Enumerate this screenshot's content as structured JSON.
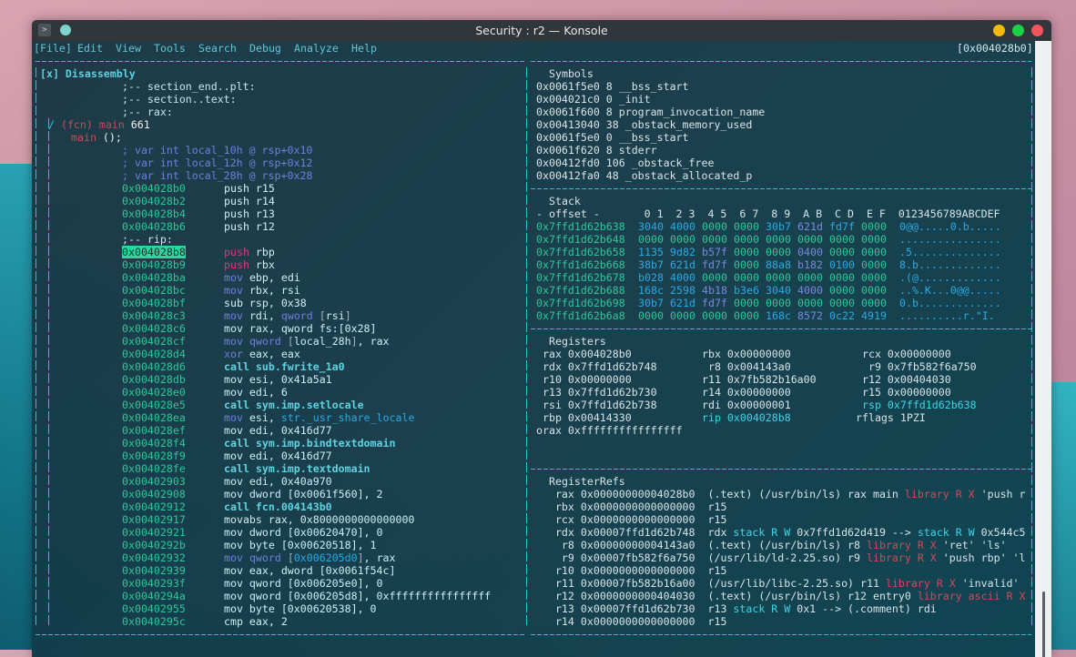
{
  "window": {
    "title": "Security : r2 — Konsole",
    "buttons": {
      "minimize_color": "#f5b90f",
      "maximize_color": "#1bd144",
      "close_color": "#f2545b"
    }
  },
  "menubar": {
    "items": [
      "[File]",
      "Edit",
      "View",
      "Tools",
      "Search",
      "Debug",
      "Analyze",
      "Help"
    ],
    "current_address": "[0x004028b0]"
  },
  "disassembly": {
    "title": "[x] Disassembly",
    "header_comments": [
      ";-- section_end..plt:",
      ";-- section..text:",
      ";-- rax:"
    ],
    "function": {
      "marker": "/",
      "label": "(fcn) main",
      "size": "661",
      "signature_name": "main",
      "signature_rest": " ();"
    },
    "vars": [
      "; var int local_10h @ rsp+0x10",
      "; var int local_12h @ rsp+0x12",
      "; var int local_28h @ rsp+0x28"
    ],
    "rip_label": ";-- rip:",
    "current_address": "0x004028b8",
    "lines": [
      {
        "addr": "0x004028b0",
        "ins": "push r15"
      },
      {
        "addr": "0x004028b2",
        "ins": "push r14"
      },
      {
        "addr": "0x004028b4",
        "ins": "push r13"
      },
      {
        "addr": "0x004028b6",
        "ins": "push r12"
      },
      {
        "rip": true
      },
      {
        "addr": "0x004028b8",
        "ins": "push rbp"
      },
      {
        "addr": "0x004028b9",
        "ins": "push rbx"
      },
      {
        "addr": "0x004028ba",
        "ins": "mov ebp, edi"
      },
      {
        "addr": "0x004028bc",
        "ins": "mov rbx, rsi"
      },
      {
        "addr": "0x004028bf",
        "ins": "sub rsp, 0x38"
      },
      {
        "addr": "0x004028c3",
        "ins": "mov rdi, qword [rsi]"
      },
      {
        "addr": "0x004028c6",
        "ins": "mov rax, qword fs:[0x28]"
      },
      {
        "addr": "0x004028cf",
        "ins": "mov qword [local_28h], rax"
      },
      {
        "addr": "0x004028d4",
        "ins": "xor eax, eax"
      },
      {
        "addr": "0x004028d6",
        "ins": "call sub.fwrite_1a0"
      },
      {
        "addr": "0x004028db",
        "ins": "mov esi, 0x41a5a1"
      },
      {
        "addr": "0x004028e0",
        "ins": "mov edi, 6"
      },
      {
        "addr": "0x004028e5",
        "ins": "call sym.imp.setlocale"
      },
      {
        "addr": "0x004028ea",
        "ins": "mov esi, str._usr_share_locale"
      },
      {
        "addr": "0x004028ef",
        "ins": "mov edi, 0x416d77"
      },
      {
        "addr": "0x004028f4",
        "ins": "call sym.imp.bindtextdomain"
      },
      {
        "addr": "0x004028f9",
        "ins": "mov edi, 0x416d77"
      },
      {
        "addr": "0x004028fe",
        "ins": "call sym.imp.textdomain"
      },
      {
        "addr": "0x00402903",
        "ins": "mov edi, 0x40a970"
      },
      {
        "addr": "0x00402908",
        "ins": "mov dword [0x0061f560], 2"
      },
      {
        "addr": "0x00402912",
        "ins": "call fcn.004143b0"
      },
      {
        "addr": "0x00402917",
        "ins": "movabs rax, 0x8000000000000000"
      },
      {
        "addr": "0x00402921",
        "ins": "mov dword [0x00620470], 0"
      },
      {
        "addr": "0x0040292b",
        "ins": "mov byte [0x00620518], 1"
      },
      {
        "addr": "0x00402932",
        "ins": "mov qword [0x006205d0], rax"
      },
      {
        "addr": "0x00402939",
        "ins": "mov eax, dword [0x0061f54c]"
      },
      {
        "addr": "0x0040293f",
        "ins": "mov qword [0x006205e0], 0"
      },
      {
        "addr": "0x0040294a",
        "ins": "mov qword [0x006205d8], 0xffffffffffffffff"
      },
      {
        "addr": "0x00402955",
        "ins": "mov byte [0x00620538], 0"
      },
      {
        "addr": "0x0040295c",
        "ins": "cmp eax, 2"
      }
    ]
  },
  "symbols": {
    "title": "Symbols",
    "rows": [
      "0x0061f5e0 8 __bss_start",
      "0x004021c0 0 _init",
      "0x0061f600 8 program_invocation_name",
      "0x00413040 38 _obstack_memory_used",
      "0x0061f5e0 0 __bss_start",
      "0x0061f620 8 stderr",
      "0x00412fd0 106 _obstack_free",
      "0x00412fa0 48 _obstack_allocated_p"
    ]
  },
  "stack": {
    "title": "Stack",
    "header": "- offset -       0 1  2 3  4 5  6 7  8 9  A B  C D  E F  0123456789ABCDEF",
    "rows": [
      {
        "offset": "0x7ffd1d62b638",
        "words": [
          "3040",
          "4000",
          "0000",
          "0000",
          "30b7",
          "621d",
          "fd7f",
          "0000"
        ],
        "ascii": "0@@.....0.b....."
      },
      {
        "offset": "0x7ffd1d62b648",
        "words": [
          "0000",
          "0000",
          "0000",
          "0000",
          "0000",
          "0000",
          "0000",
          "0000"
        ],
        "ascii": "................"
      },
      {
        "offset": "0x7ffd1d62b658",
        "words": [
          "1135",
          "9d82",
          "b57f",
          "0000",
          "0000",
          "0400",
          "0000",
          "0000"
        ],
        "ascii": ".5.............."
      },
      {
        "offset": "0x7ffd1d62b668",
        "words": [
          "38b7",
          "621d",
          "fd7f",
          "0000",
          "88a8",
          "b182",
          "0100",
          "0000"
        ],
        "ascii": "8.b............."
      },
      {
        "offset": "0x7ffd1d62b678",
        "words": [
          "b028",
          "4000",
          "0000",
          "0000",
          "0000",
          "0000",
          "0000",
          "0000"
        ],
        "ascii": ".(@............."
      },
      {
        "offset": "0x7ffd1d62b688",
        "words": [
          "168c",
          "2598",
          "4b18",
          "b3e6",
          "3040",
          "4000",
          "0000",
          "0000"
        ],
        "ascii": "..%.K...0@@....."
      },
      {
        "offset": "0x7ffd1d62b698",
        "words": [
          "30b7",
          "621d",
          "fd7f",
          "0000",
          "0000",
          "0000",
          "0000",
          "0000"
        ],
        "ascii": "0.b............."
      },
      {
        "offset": "0x7ffd1d62b6a8",
        "words": [
          "0000",
          "0000",
          "0000",
          "0000",
          "168c",
          "8572",
          "0c22",
          "4919"
        ],
        "ascii": "..........r.\"I."
      }
    ]
  },
  "registers": {
    "title": "Registers",
    "rows": [
      [
        {
          "name": "rax",
          "value": "0x004028b0"
        },
        {
          "name": "rbx",
          "value": "0x00000000"
        },
        {
          "name": "rcx",
          "value": "0x00000000"
        }
      ],
      [
        {
          "name": "rdx",
          "value": "0x7ffd1d62b748"
        },
        {
          "name": "r8",
          "value": "0x004143a0"
        },
        {
          "name": "r9",
          "value": "0x7fb582f6a750"
        }
      ],
      [
        {
          "name": "r10",
          "value": "0x00000000"
        },
        {
          "name": "r11",
          "value": "0x7fb582b16a00"
        },
        {
          "name": "r12",
          "value": "0x00404030"
        }
      ],
      [
        {
          "name": "r13",
          "value": "0x7ffd1d62b730"
        },
        {
          "name": "r14",
          "value": "0x00000000"
        },
        {
          "name": "r15",
          "value": "0x00000000"
        }
      ],
      [
        {
          "name": "rsi",
          "value": "0x7ffd1d62b738"
        },
        {
          "name": "rdi",
          "value": "0x00000001"
        },
        {
          "name": "rsp",
          "value": "0x7ffd1d62b638",
          "highlight": true
        }
      ],
      [
        {
          "name": "rbp",
          "value": "0x00414330"
        },
        {
          "name": "rip",
          "value": "0x004028b8",
          "highlight": true
        },
        {
          "name": "rflags",
          "value": "1PZI"
        }
      ],
      [
        {
          "name": "orax",
          "value": "0xffffffffffffffff"
        }
      ]
    ]
  },
  "register_refs": {
    "title": "RegisterRefs",
    "rows": [
      {
        "name": "rax",
        "value": "0x00000000004028b0",
        "desc": [
          [
            "(.text) (/usr/bin/ls) rax main ",
            "light"
          ],
          [
            "library R X",
            "red"
          ],
          [
            " 'push r",
            "light"
          ]
        ]
      },
      {
        "name": "rbx",
        "value": "0x0000000000000000",
        "desc": [
          [
            "r15",
            "light"
          ]
        ]
      },
      {
        "name": "rcx",
        "value": "0x0000000000000000",
        "desc": [
          [
            "r15",
            "light"
          ]
        ]
      },
      {
        "name": "rdx",
        "value": "0x00007ffd1d62b748",
        "desc": [
          [
            "rdx ",
            "light"
          ],
          [
            "stack R W",
            "cy"
          ],
          [
            " 0x7ffd1d62d419 --> ",
            "light"
          ],
          [
            "stack R W",
            "cy"
          ],
          [
            " 0x544c5",
            "light"
          ]
        ]
      },
      {
        "name": "r8",
        "value": "0x00000000004143a0",
        "desc": [
          [
            "(.text) (/usr/bin/ls) r8 ",
            "light"
          ],
          [
            "library R X",
            "red"
          ],
          [
            " 'ret' 'ls'",
            "light"
          ]
        ]
      },
      {
        "name": "r9",
        "value": "0x00007fb582f6a750",
        "desc": [
          [
            "(/usr/lib/ld-2.25.so) r9 ",
            "light"
          ],
          [
            "library R X",
            "red"
          ],
          [
            " 'push rbp' 'l",
            "light"
          ]
        ]
      },
      {
        "name": "r10",
        "value": "0x0000000000000000",
        "desc": [
          [
            "r15",
            "light"
          ]
        ]
      },
      {
        "name": "r11",
        "value": "0x00007fb582b16a00",
        "desc": [
          [
            "(/usr/lib/libc-2.25.so) r11 ",
            "light"
          ],
          [
            "library R X",
            "red"
          ],
          [
            " 'invalid'",
            "light"
          ]
        ]
      },
      {
        "name": "r12",
        "value": "0x0000000000404030",
        "desc": [
          [
            "(.text) (/usr/bin/ls) r12 entry0 ",
            "light"
          ],
          [
            "library ascii R X",
            "red"
          ]
        ]
      },
      {
        "name": "r13",
        "value": "0x00007ffd1d62b730",
        "desc": [
          [
            "r13 ",
            "light"
          ],
          [
            "stack R W",
            "cy"
          ],
          [
            " 0x1 --> (.comment) rdi",
            "light"
          ]
        ]
      },
      {
        "name": "r14",
        "value": "0x0000000000000000",
        "desc": [
          [
            "r15",
            "light"
          ]
        ]
      }
    ]
  }
}
